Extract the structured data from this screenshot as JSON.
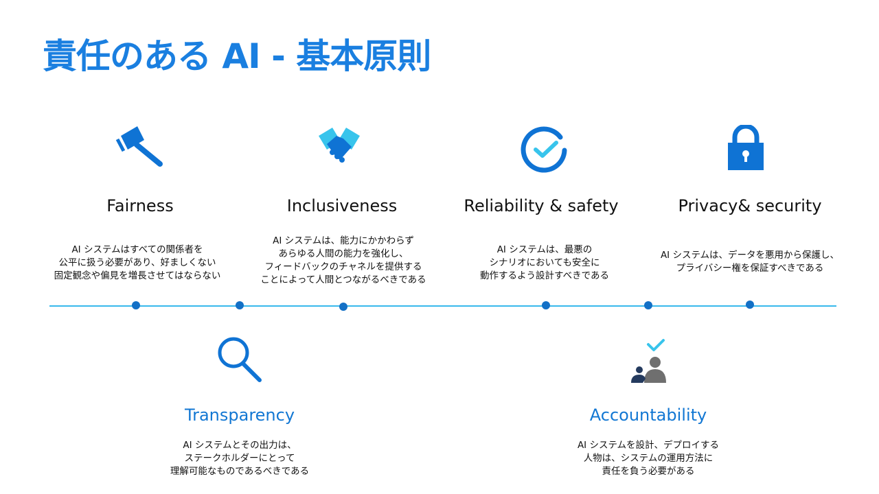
{
  "title": "責任のある AI  - 基本原則",
  "colors": {
    "title": "#1a7fe0",
    "icon_blue": "#0f73d4",
    "icon_light": "#38c4ec",
    "heading_blue": "#1277d3",
    "timeline": "#37b9ec",
    "dot": "#1370c6",
    "person_gray": "#6f6f6f",
    "person_dark": "#243a5e"
  },
  "principles_top": [
    {
      "heading": "Fairness",
      "icon": "gavel-icon",
      "lines": [
        "AI システムはすべての関係者を",
        "公平に扱う必要があり、好ましくない",
        "固定観念や偏見を増長させてはならない"
      ]
    },
    {
      "heading": "Inclusiveness",
      "icon": "handshake-icon",
      "lines": [
        "AI システムは、能力にかかわらず",
        "あらゆる人間の能力を強化し、",
        "フィードバックのチャネルを提供する",
        "ことによって人間とつながるべきである"
      ]
    },
    {
      "heading": "Reliability & safety",
      "icon": "checkmark-circle-icon",
      "lines": [
        "AI システムは、最悪の",
        "シナリオにおいても安全に",
        "動作するよう設計すべきである"
      ]
    },
    {
      "heading": "Privacy& security",
      "icon": "padlock-icon",
      "lines": [
        "AI システムは、データを悪用から保護し、",
        "プライバシー権を保証すべきである"
      ]
    }
  ],
  "principles_bottom": [
    {
      "heading": "Transparency",
      "icon": "magnifier-icon",
      "lines": [
        "AI システムとその出力は、",
        "ステークホルダーにとって",
        "理解可能なものであるべきである"
      ]
    },
    {
      "heading": "Accountability",
      "icon": "people-check-icon",
      "lines": [
        "AI システムを設計、デプロイする",
        "人物は、システムの運用方法に",
        "責任を負う必要がある"
      ]
    }
  ]
}
